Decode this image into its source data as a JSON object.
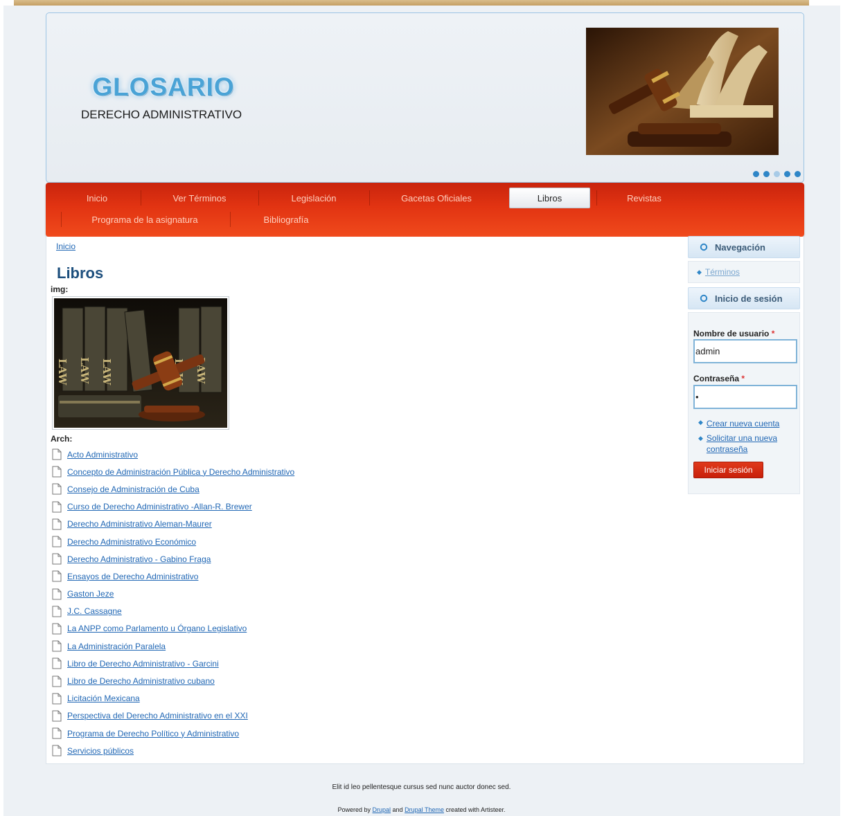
{
  "header": {
    "site_name": "GLOSARIO",
    "site_slogan": "DERECHO ADMINISTRATIVO"
  },
  "menu": {
    "items": [
      {
        "label": "Inicio"
      },
      {
        "label": "Ver Términos"
      },
      {
        "label": "Legislación"
      },
      {
        "label": "Gacetas Oficiales"
      },
      {
        "label": "Libros",
        "active": true
      },
      {
        "label": "Revistas"
      },
      {
        "label": "Programa de la asignatura"
      },
      {
        "label": "Bibliografía"
      }
    ]
  },
  "breadcrumb": {
    "home": "Inicio"
  },
  "page": {
    "title": "Libros",
    "img_label": "img:",
    "arch_label": "Arch:"
  },
  "files": [
    "Acto Administrativo",
    "Concepto de Administración Pública y Derecho Administrativo",
    "Consejo de Administración de Cuba",
    "Curso de Derecho Administrativo -Allan-R. Brewer",
    "Derecho Administrativo Aleman-Maurer",
    "Derecho Administrativo Económico",
    "Derecho Administrativo - Gabino Fraga",
    "Ensayos de Derecho Administrativo",
    "Gaston Jeze",
    "J.C. Cassagne",
    "La ANPP como Parlamento u Órgano Legislativo",
    "La Administración Paralela",
    "Libro de Derecho Administrativo - Garcini",
    "Libro de Derecho Administrativo cubano",
    "Licitación Mexicana",
    "Perspectiva del Derecho Administrativo en el XXI",
    "Programa de Derecho Político y Administrativo",
    "Servicios públicos"
  ],
  "sidebar": {
    "navigation": {
      "title": "Navegación",
      "link": "Términos"
    },
    "login": {
      "title": "Inicio de sesión",
      "username_label": "Nombre de usuario",
      "username_value": "admin",
      "password_label": "Contraseña",
      "password_value": "•",
      "required_mark": "*",
      "create_account": "Crear nueva cuenta",
      "request_password": "Solicitar una nueva contraseña",
      "submit": "Iniciar sesión"
    }
  },
  "footer": {
    "line1": "Elit id leo pellentesque cursus sed nunc auctor donec sed.",
    "powered_by": "Powered by",
    "drupal": "Drupal",
    "and": "and",
    "drupal_theme": "Drupal Theme",
    "created_with": "created with Artisteer."
  },
  "colors": {
    "menu_red": "#e23412",
    "link_blue": "#1f66b4",
    "title_blue": "#1d4f7d",
    "accent_blue": "#2f86c7"
  }
}
